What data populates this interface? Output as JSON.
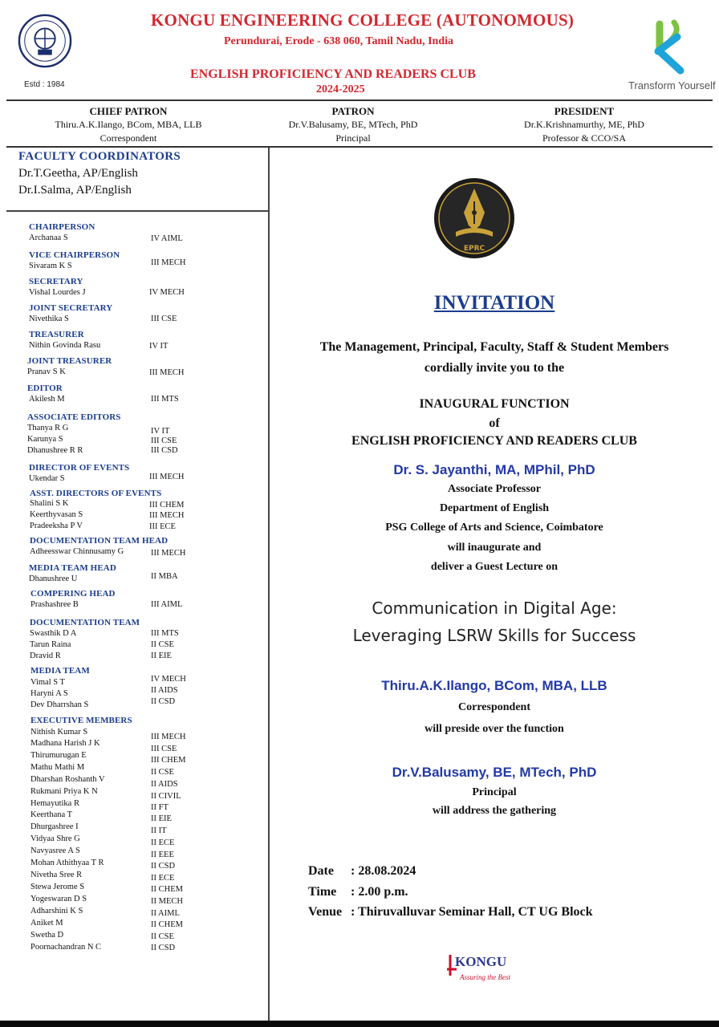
{
  "header": {
    "college_name": "KONGU ENGINEERING COLLEGE (AUTONOMOUS)",
    "address": "Perundurai, Erode - 638 060, Tamil Nadu, India",
    "club_name": "ENGLISH PROFICIENCY AND READERS CLUB",
    "year": "2024-2025",
    "estd": "Estd : 1984",
    "tagline": "Transform Yourself"
  },
  "patrons": [
    {
      "title": "CHIEF PATRON",
      "name": "Thiru.A.K.Ilango, BCom, MBA, LLB",
      "role": "Correspondent"
    },
    {
      "title": "PATRON",
      "name": "Dr.V.Balusamy, BE, MTech, PhD",
      "role": "Principal"
    },
    {
      "title": "PRESIDENT",
      "name": "Dr.K.Krishnamurthy, ME, PhD",
      "role": "Professor & CCO/SA"
    }
  ],
  "faculty": {
    "title": "FACULTY COORDINATORS",
    "members": [
      "Dr.T.Geetha, AP/English",
      "Dr.I.Salma, AP/English"
    ]
  },
  "office_bearers": [
    {
      "role": "CHAIRPERSON",
      "members": [
        {
          "name": "Archanaa S",
          "dept": "IV AIML"
        }
      ]
    },
    {
      "role": "VICE CHAIRPERSON",
      "members": [
        {
          "name": "Sivaram K S",
          "dept": "III MECH"
        }
      ]
    },
    {
      "role": "SECRETARY",
      "members": [
        {
          "name": "Vishal Lourdes J",
          "dept": "IV MECH"
        }
      ]
    },
    {
      "role": "JOINT SECRETARY",
      "members": [
        {
          "name": "Nivethika S",
          "dept": "III CSE"
        }
      ]
    },
    {
      "role": "TREASURER",
      "members": [
        {
          "name": "Nithin Govinda Rasu",
          "dept": "IV IT"
        }
      ]
    },
    {
      "role": "JOINT TREASURER",
      "members": [
        {
          "name": "Pranav S K",
          "dept": "III MECH"
        }
      ]
    },
    {
      "role": "EDITOR",
      "members": [
        {
          "name": "Akilesh M",
          "dept": "III MTS"
        }
      ]
    },
    {
      "role": "ASSOCIATE EDITORS",
      "members": [
        {
          "name": "Thanya R G",
          "dept": "IV IT"
        },
        {
          "name": "Karunya S",
          "dept": "III CSE"
        },
        {
          "name": "Dhanushree R R",
          "dept": "III CSD"
        }
      ]
    },
    {
      "role": "DIRECTOR OF EVENTS",
      "members": [
        {
          "name": "Ukendar S",
          "dept": "III MECH"
        }
      ]
    },
    {
      "role": "ASST. DIRECTORS OF EVENTS",
      "members": [
        {
          "name": "Shalini S K",
          "dept": "III CHEM"
        },
        {
          "name": "Keerthyvasan S",
          "dept": "III MECH"
        },
        {
          "name": "Pradeeksha P V",
          "dept": "III ECE"
        }
      ]
    },
    {
      "role": "DOCUMENTATION TEAM HEAD",
      "members": [
        {
          "name": "Adheesswar Chinnusamy G",
          "dept": "III MECH"
        }
      ]
    },
    {
      "role": "MEDIA TEAM HEAD",
      "members": [
        {
          "name": "Dhanushree U",
          "dept": "II MBA"
        }
      ]
    },
    {
      "role": "COMPERING HEAD",
      "members": [
        {
          "name": "Prashashree B",
          "dept": "III AIML"
        }
      ]
    },
    {
      "role": "DOCUMENTATION TEAM",
      "members": [
        {
          "name": "Swasthik D A",
          "dept": "III MTS"
        },
        {
          "name": "Tarun Raina",
          "dept": "II CSE"
        },
        {
          "name": "Dravid R",
          "dept": "II EIE"
        }
      ]
    },
    {
      "role": "MEDIA TEAM",
      "members": [
        {
          "name": "Vimal S T",
          "dept": "IV MECH"
        },
        {
          "name": "Haryni A S",
          "dept": "II AIDS"
        },
        {
          "name": "Dev Dharrshan S",
          "dept": "II CSD"
        }
      ]
    },
    {
      "role": "EXECUTIVE MEMBERS",
      "members": [
        {
          "name": "Nithish Kumar S",
          "dept": "III MECH"
        },
        {
          "name": "Madhana Harish J K",
          "dept": "III CSE"
        },
        {
          "name": "Thirumurugan E",
          "dept": "III CHEM"
        },
        {
          "name": "Mathu Mathi M",
          "dept": "II CSE"
        },
        {
          "name": "Dharshan Roshanth V",
          "dept": "II AIDS"
        },
        {
          "name": "Rukmani Priya K N",
          "dept": "II CIVIL"
        },
        {
          "name": "Hemayutika R",
          "dept": "II FT"
        },
        {
          "name": "Keerthana T",
          "dept": "II EIE"
        },
        {
          "name": "Dhurgashree I",
          "dept": "II IT"
        },
        {
          "name": "Vidyaa Shre G",
          "dept": "II ECE"
        },
        {
          "name": "Navyasree A S",
          "dept": "II EEE"
        },
        {
          "name": "Mohan Athithyaa T R",
          "dept": "II CSD"
        },
        {
          "name": "Nivetha Sree R",
          "dept": "II ECE"
        },
        {
          "name": "Stewa Jerome S",
          "dept": "II CHEM"
        },
        {
          "name": "Yogeswaran D S",
          "dept": "II MECH"
        },
        {
          "name": "Adharshini K S",
          "dept": "II AIML"
        },
        {
          "name": "Aniket M",
          "dept": "II CHEM"
        },
        {
          "name": "Swetha D",
          "dept": "II CSE"
        },
        {
          "name": "Poornachandran N C",
          "dept": "II CSD"
        }
      ]
    }
  ],
  "invitation": {
    "emblem_text": "EPRC",
    "title": "INVITATION",
    "intro_line1": "The Management, Principal, Faculty, Staff & Student Members",
    "intro_line2": "cordially invite you to the",
    "event_line1": "INAUGURAL FUNCTION",
    "event_line2": "of",
    "event_line3": "ENGLISH PROFICIENCY AND READERS CLUB",
    "guest_name": "Dr. S. Jayanthi, MA, MPhil, PhD",
    "guest_desig": "Associate Professor",
    "guest_dept": "Department of English",
    "guest_inst": "PSG College of Arts and Science, Coimbatore",
    "guest_role1": "will inaugurate and",
    "guest_role2": "deliver a Guest Lecture on",
    "topic_line1": "Communication in Digital Age:",
    "topic_line2": "Leveraging LSRW Skills for Success",
    "preside_name": "Thiru.A.K.Ilango, BCom, MBA, LLB",
    "preside_desig": "Correspondent",
    "preside_role": "will preside over the function",
    "address_name": "Dr.V.Balusamy, BE, MTech, PhD",
    "address_desig": "Principal",
    "address_role": "will address the gathering",
    "date_label": "Date",
    "date_value": ": 28.08.2024",
    "time_label": "Time",
    "time_value": ": 2.00 p.m.",
    "venue_label": "Venue",
    "venue_value": ": Thiruvalluvar Seminar Hall, CT UG Block",
    "kongu_logo_text": "KONGU",
    "kongu_slogan": "Assuring the Best"
  },
  "colors": {
    "header_red": "#d4262c",
    "role_blue": "#1b3d8f",
    "speaker_blue": "#2339a8",
    "emblem_gold": "#c9a23a"
  }
}
